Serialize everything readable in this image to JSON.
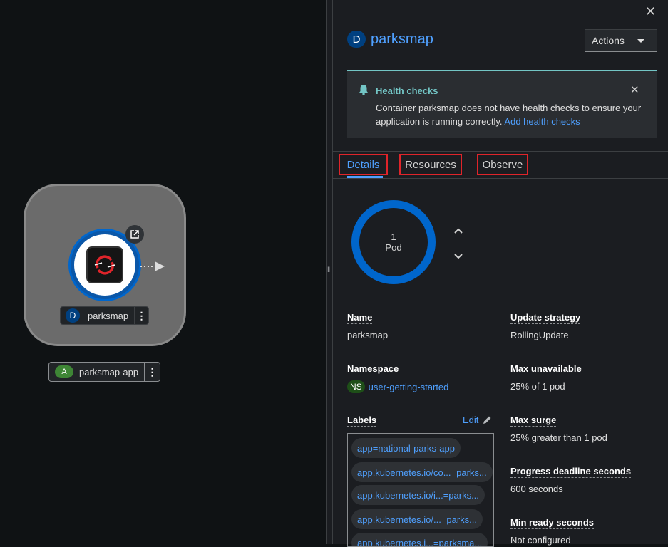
{
  "topology": {
    "node_name": "parksmap",
    "node_badge": "D",
    "group_name": "parksmap-app",
    "group_badge": "A"
  },
  "panel": {
    "badge": "D",
    "title": "parksmap",
    "actions_label": "Actions",
    "alert": {
      "title": "Health checks",
      "body": "Container parksmap does not have health checks to ensure your application is running correctly.",
      "link": "Add health checks"
    },
    "tabs": [
      "Details",
      "Resources",
      "Observe"
    ],
    "pods": {
      "count": "1",
      "label": "Pod"
    },
    "fields": {
      "name_label": "Name",
      "name_value": "parksmap",
      "namespace_label": "Namespace",
      "namespace_badge": "NS",
      "namespace_value": "user-getting-started",
      "labels_label": "Labels",
      "edit_label": "Edit",
      "update_strategy_label": "Update strategy",
      "update_strategy_value": "RollingUpdate",
      "max_unavailable_label": "Max unavailable",
      "max_unavailable_value": "25% of 1 pod",
      "max_surge_label": "Max surge",
      "max_surge_value": "25% greater than 1 pod",
      "progress_deadline_label": "Progress deadline seconds",
      "progress_deadline_value": "600 seconds",
      "min_ready_label": "Min ready seconds",
      "min_ready_value": "Not configured"
    },
    "labels": [
      "app=national-parks-app",
      "app.kubernetes.io/co...=parks...",
      "app.kubernetes.io/i...=parks...",
      "app.kubernetes.io/...=parks...",
      "app.kubernetes.i...=parksma..."
    ]
  },
  "colors": {
    "accent": "#4fa0ff",
    "pod_ring": "#0066cc",
    "alert_teal": "#73c5c5",
    "highlight_red": "#e0242a"
  }
}
